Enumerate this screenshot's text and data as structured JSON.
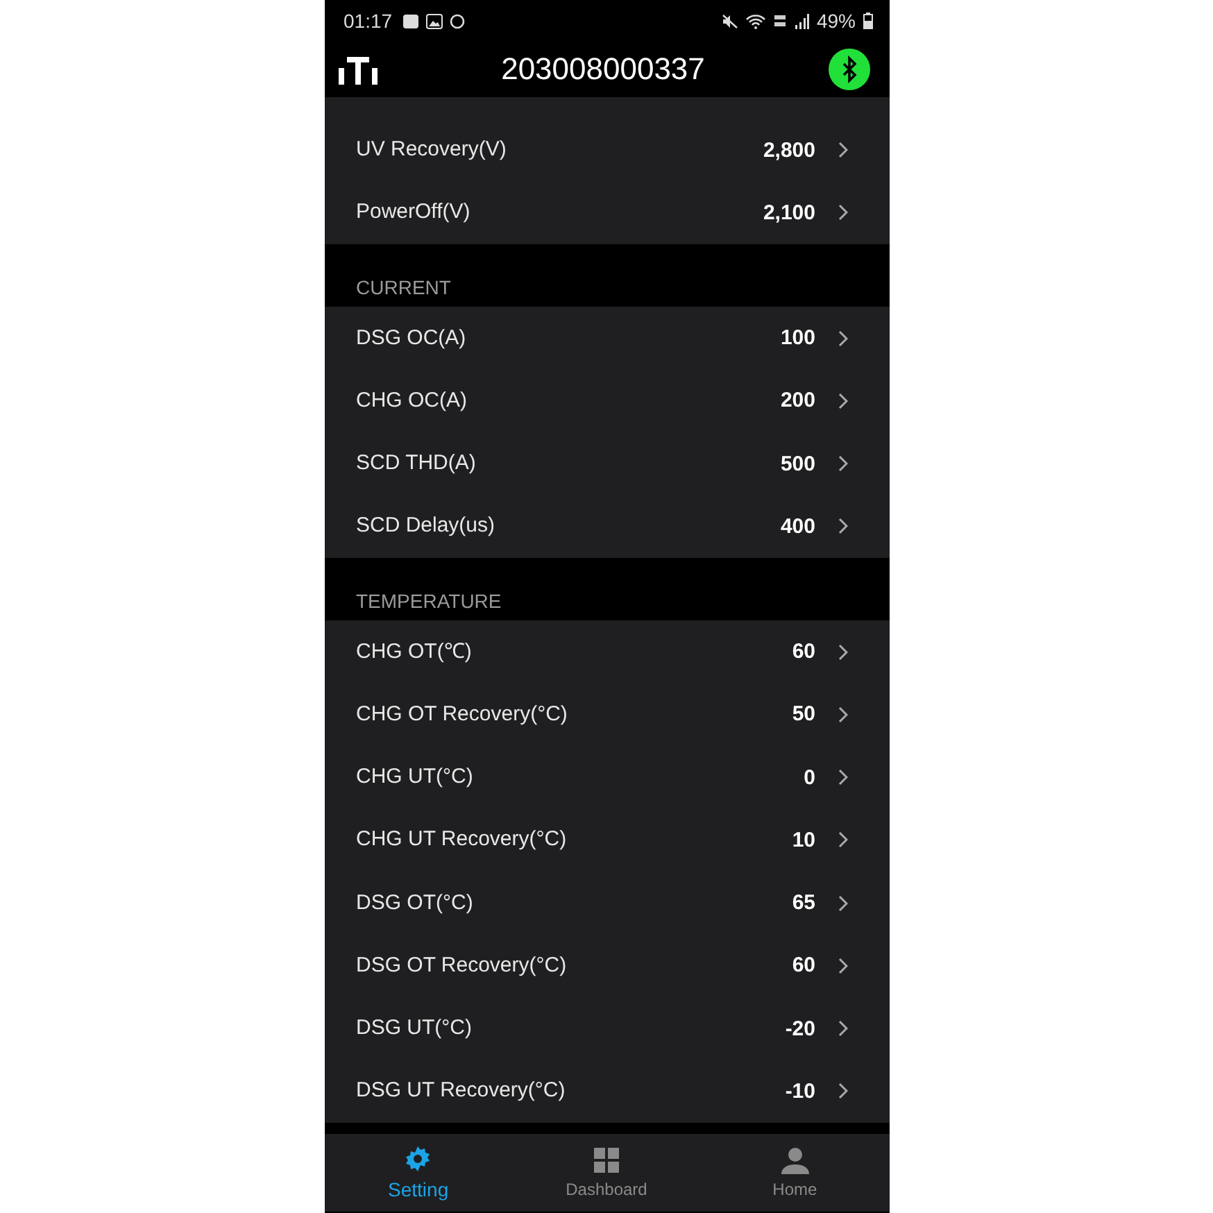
{
  "status_bar": {
    "time": "01:17",
    "battery": "49%"
  },
  "header": {
    "title": "203008000337",
    "bluetooth_connected": true
  },
  "sections": [
    {
      "rows": [
        {
          "label": "UV Recovery(V)",
          "value": "2,800"
        },
        {
          "label": "PowerOff(V)",
          "value": "2,100"
        }
      ]
    },
    {
      "title": "CURRENT",
      "rows": [
        {
          "label": "DSG OC(A)",
          "value": "100"
        },
        {
          "label": "CHG OC(A)",
          "value": "200"
        },
        {
          "label": "SCD THD(A)",
          "value": "500"
        },
        {
          "label": "SCD Delay(us)",
          "value": "400"
        }
      ]
    },
    {
      "title": "TEMPERATURE",
      "rows": [
        {
          "label": "CHG OT(℃)",
          "value": "60"
        },
        {
          "label": "CHG OT Recovery(°C)",
          "value": "50"
        },
        {
          "label": "CHG UT(°C)",
          "value": "0"
        },
        {
          "label": "CHG UT Recovery(°C)",
          "value": "10"
        },
        {
          "label": "DSG OT(°C)",
          "value": "65"
        },
        {
          "label": "DSG OT Recovery(°C)",
          "value": "60"
        },
        {
          "label": "DSG UT(°C)",
          "value": "-20"
        },
        {
          "label": "DSG UT Recovery(°C)",
          "value": "-10"
        }
      ]
    }
  ],
  "nav": [
    {
      "kind": "gear",
      "label": "Setting",
      "selected": true
    },
    {
      "kind": "grid",
      "label": "Dashboard",
      "selected": false
    },
    {
      "kind": "person",
      "label": "Home",
      "selected": false
    }
  ]
}
